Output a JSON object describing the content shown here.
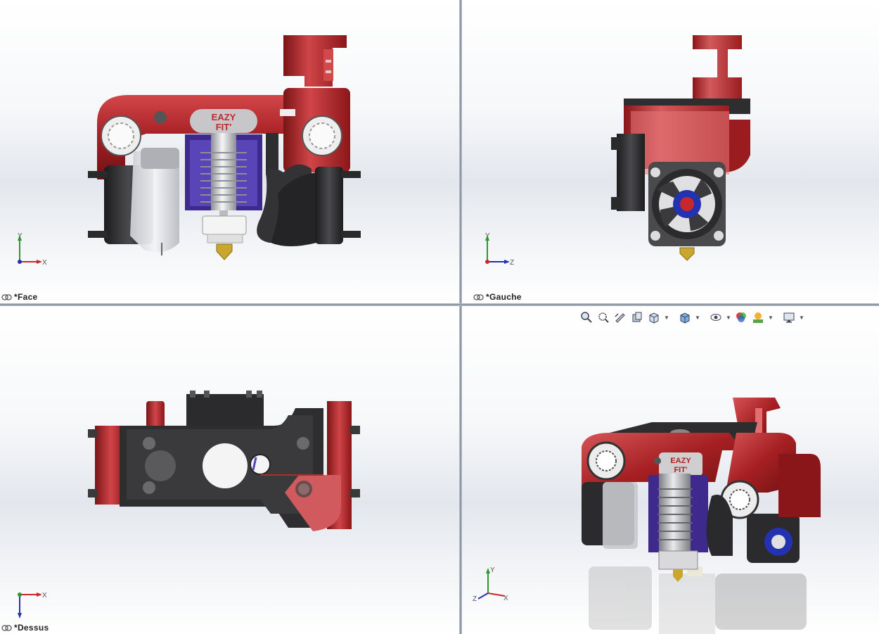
{
  "viewports": {
    "top_left": {
      "label": "*Face"
    },
    "top_right": {
      "label": "*Gauche"
    },
    "bottom_left": {
      "label": "*Dessus"
    },
    "bottom_right": {
      "label": ""
    }
  },
  "model": {
    "brand_line1": "EAZY",
    "brand_line2": "FIT'"
  },
  "triads": {
    "face": {
      "up": "Y",
      "right": "X"
    },
    "gauche": {
      "up": "Y",
      "right": "Z"
    },
    "dessus": {
      "up": "Z",
      "right": "X"
    },
    "isometric": {
      "up": "Y",
      "right": "X",
      "left": "Z"
    }
  },
  "toolbar": {
    "icons": [
      "zoom-to-fit-icon",
      "zoom-to-area-icon",
      "previous-view-icon",
      "section-view-icon",
      "view-orientation-icon",
      "display-style-icon",
      "hide-show-items-icon",
      "edit-appearance-icon",
      "apply-scene-icon",
      "view-settings-icon"
    ]
  },
  "colors": {
    "red": "#a51f22",
    "dark": "#2b2b2d",
    "purple": "#3d2a8c",
    "brass": "#c9a72e"
  }
}
